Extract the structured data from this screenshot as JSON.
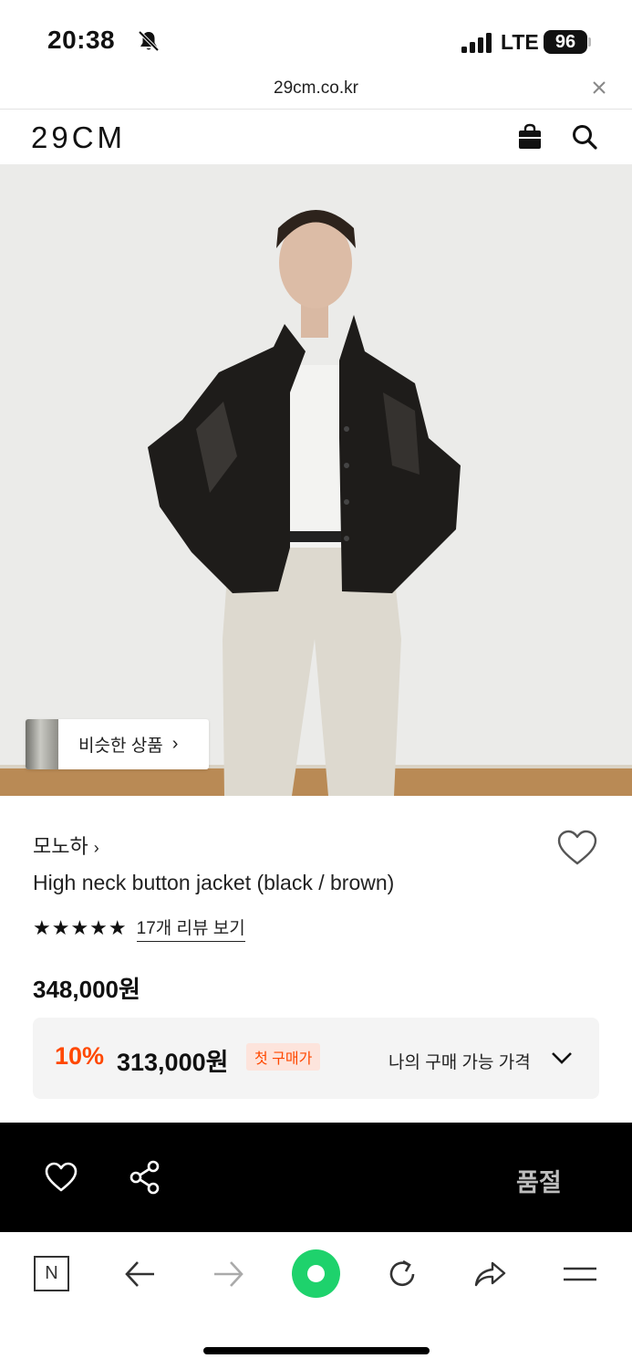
{
  "status_bar": {
    "time": "20:38",
    "network": "LTE",
    "battery": "96",
    "icons": [
      "bell-slash-icon",
      "signal-bars-icon"
    ]
  },
  "url_bar": {
    "url": "29cm.co.kr",
    "close_icon": "close-icon"
  },
  "header": {
    "logo": "29CM",
    "icons": [
      "shopping-bag-icon",
      "search-icon"
    ]
  },
  "product": {
    "similar_button_label": "비슷한 상품",
    "similar_chevron": "›",
    "brand": "모노하",
    "brand_chevron": "›",
    "name": "High neck button jacket (black / brown)",
    "stars": "★★★★★",
    "rating_stars": 5,
    "review_link": "17개 리뷰 보기",
    "price": "348,000원",
    "discount": {
      "rate": "10%",
      "price": "313,000원",
      "badge": "첫 구매가",
      "my_price_label": "나의 구매 가능 가격"
    },
    "colors": {
      "discount_accent": "#ff4800",
      "badge_bg": "#fde4dc",
      "price_box_bg": "#f4f4f4"
    }
  },
  "action_bar": {
    "sold_out_label": "품절",
    "icons": [
      "heart-outline-icon",
      "share-icon"
    ]
  },
  "browser_toolbar": {
    "naver_label": "N",
    "icons": [
      "naver-icon",
      "back-arrow-icon",
      "forward-arrow-icon",
      "green-dot-icon",
      "reload-icon",
      "share-arrow-icon",
      "menu-icon"
    ],
    "accent": "#1ed26c"
  }
}
